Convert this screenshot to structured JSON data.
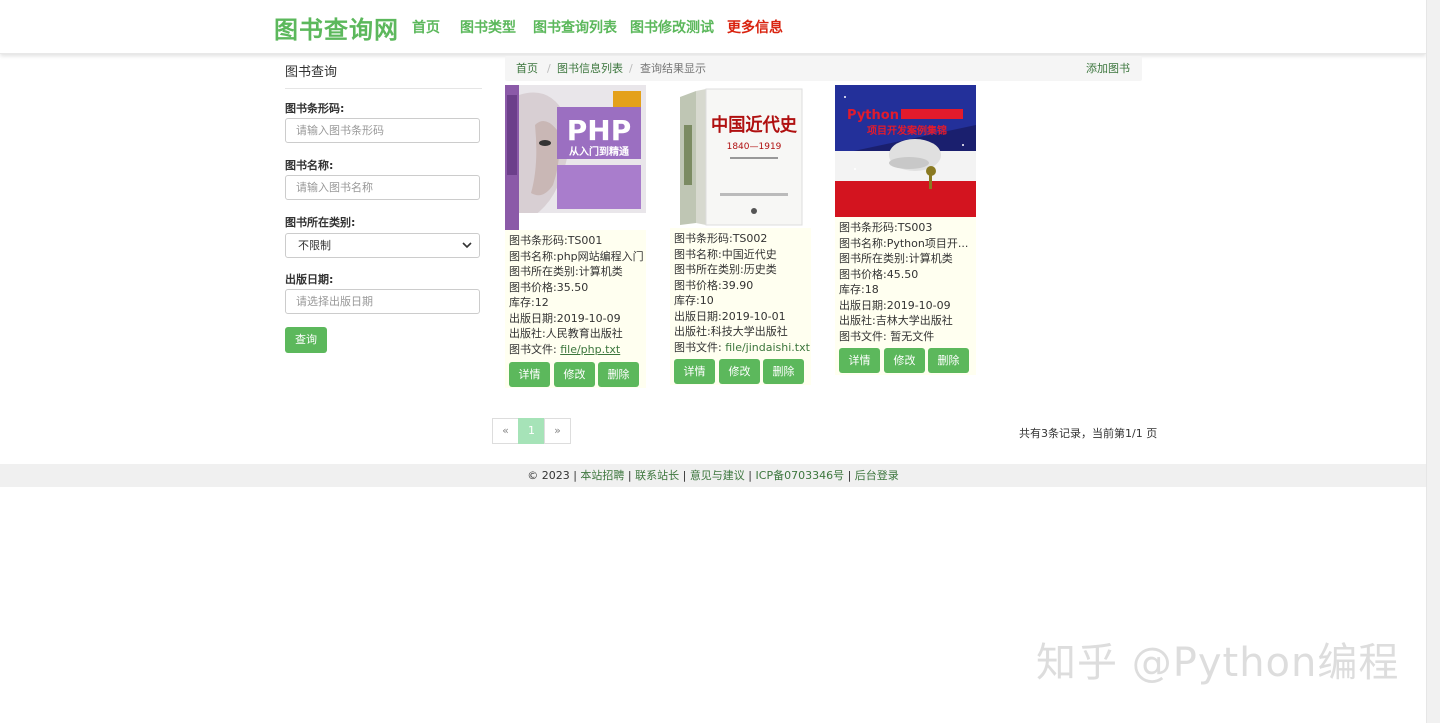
{
  "header": {
    "brand": "图书查询网",
    "nav": [
      "首页",
      "图书类型",
      "图书查询列表",
      "图书修改测试",
      "更多信息"
    ]
  },
  "sidebar": {
    "title": "图书查询",
    "barcode_label": "图书条形码:",
    "barcode_placeholder": "请输入图书条形码",
    "name_label": "图书名称:",
    "name_placeholder": "请输入图书名称",
    "category_label": "图书所在类别:",
    "category_value": "不限制",
    "date_label": "出版日期:",
    "date_placeholder": "请选择出版日期",
    "query_button": "查询"
  },
  "breadcrumb": {
    "items": [
      "首页",
      "图书信息列表",
      "查询结果显示"
    ],
    "add_book": "添加图书"
  },
  "books": [
    {
      "cover_title": "PHP",
      "cover_subtitle": "从入门到精通",
      "barcode": "图书条形码:TS001",
      "name": "图书名称:php网站编程入门",
      "category": "图书所在类别:计算机类",
      "price": "图书价格:35.50",
      "stock": "库存:12",
      "date": "出版日期:2019-10-09",
      "publisher": "出版社:人民教育出版社",
      "file_label": "图书文件: ",
      "file_link": "file/php.txt"
    },
    {
      "cover_title": "中国近代史",
      "cover_subtitle": "1840—1919",
      "barcode": "图书条形码:TS002",
      "name": "图书名称:中国近代史",
      "category": "图书所在类别:历史类",
      "price": "图书价格:39.90",
      "stock": "库存:10",
      "date": "出版日期:2019-10-01",
      "publisher": "出版社:科技大学出版社",
      "file_label": "图书文件: ",
      "file_link": "file/jindaishi.txt"
    },
    {
      "cover_title": "Python",
      "cover_subtitle": "项目开发案例集锦",
      "barcode": "图书条形码:TS003",
      "name": "图书名称:Python项目开...",
      "category": "图书所在类别:计算机类",
      "price": "图书价格:45.50",
      "stock": "库存:18",
      "date": "出版日期:2019-10-09",
      "publisher": "出版社:吉林大学出版社",
      "file_label": "图书文件: ",
      "file_text": "暂无文件"
    }
  ],
  "card_buttons": [
    "详情",
    "修改",
    "删除"
  ],
  "pagination": {
    "prev": "«",
    "current": "1",
    "next": "»",
    "info": "共有3条记录，当前第1/1 页"
  },
  "footer": {
    "copyright": "© 2023 | ",
    "links": [
      "本站招聘",
      "联系站长",
      "意见与建议",
      "ICP备0703346号",
      "后台登录"
    ],
    "sep": " | "
  },
  "watermark": "知乎 @Python编程",
  "colors": {
    "brand": "#5cb85c",
    "more": "#d9230f",
    "link": "#3c763d"
  }
}
